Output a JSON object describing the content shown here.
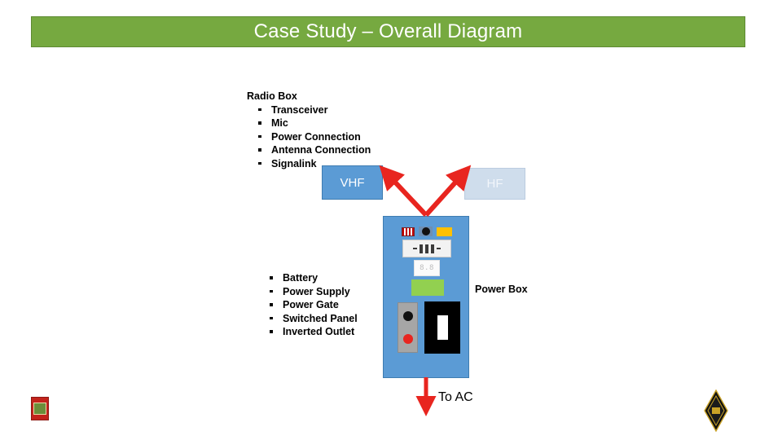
{
  "slide": {
    "title": "Case Study – Overall Diagram",
    "banner_color": "#76A940",
    "background": "#FFFFFF"
  },
  "radio_block": {
    "heading": "Radio Box",
    "items": [
      "Transceiver",
      "Mic",
      "Power Connection",
      "Antenna Connection",
      "Signalink"
    ]
  },
  "power_block": {
    "items": [
      "Battery",
      "Power Supply",
      "Power Gate",
      "Switched Panel",
      "Inverted Outlet"
    ]
  },
  "bands": {
    "vhf": {
      "label": "VHF",
      "fill": "#5B9BD5",
      "text_color": "#FFFFFF"
    },
    "hf": {
      "label": "HF",
      "fill": "#CFDDEC",
      "text_color": "#F2F6FB"
    }
  },
  "power_box": {
    "label": "Power Box",
    "fill": "#5B9BD5",
    "meter_value": "8.8",
    "parts": {
      "striped_fuse": "striped-fuse-part",
      "knob": "knob-part",
      "yellow_module": "yellow-module-part",
      "switched_panel": "switched-panel-part",
      "meter": "meter-display",
      "battery": "green-battery-block",
      "binding_posts": "binding-post-strip",
      "outlet": "inverted-outlet"
    }
  },
  "to_ac": {
    "label": "To AC",
    "arrow_color": "#E8251F"
  },
  "arrows": {
    "color": "#E8251F"
  },
  "logos": {
    "left": "red-emblem-logo",
    "right": "arrl-diamond-logo"
  }
}
